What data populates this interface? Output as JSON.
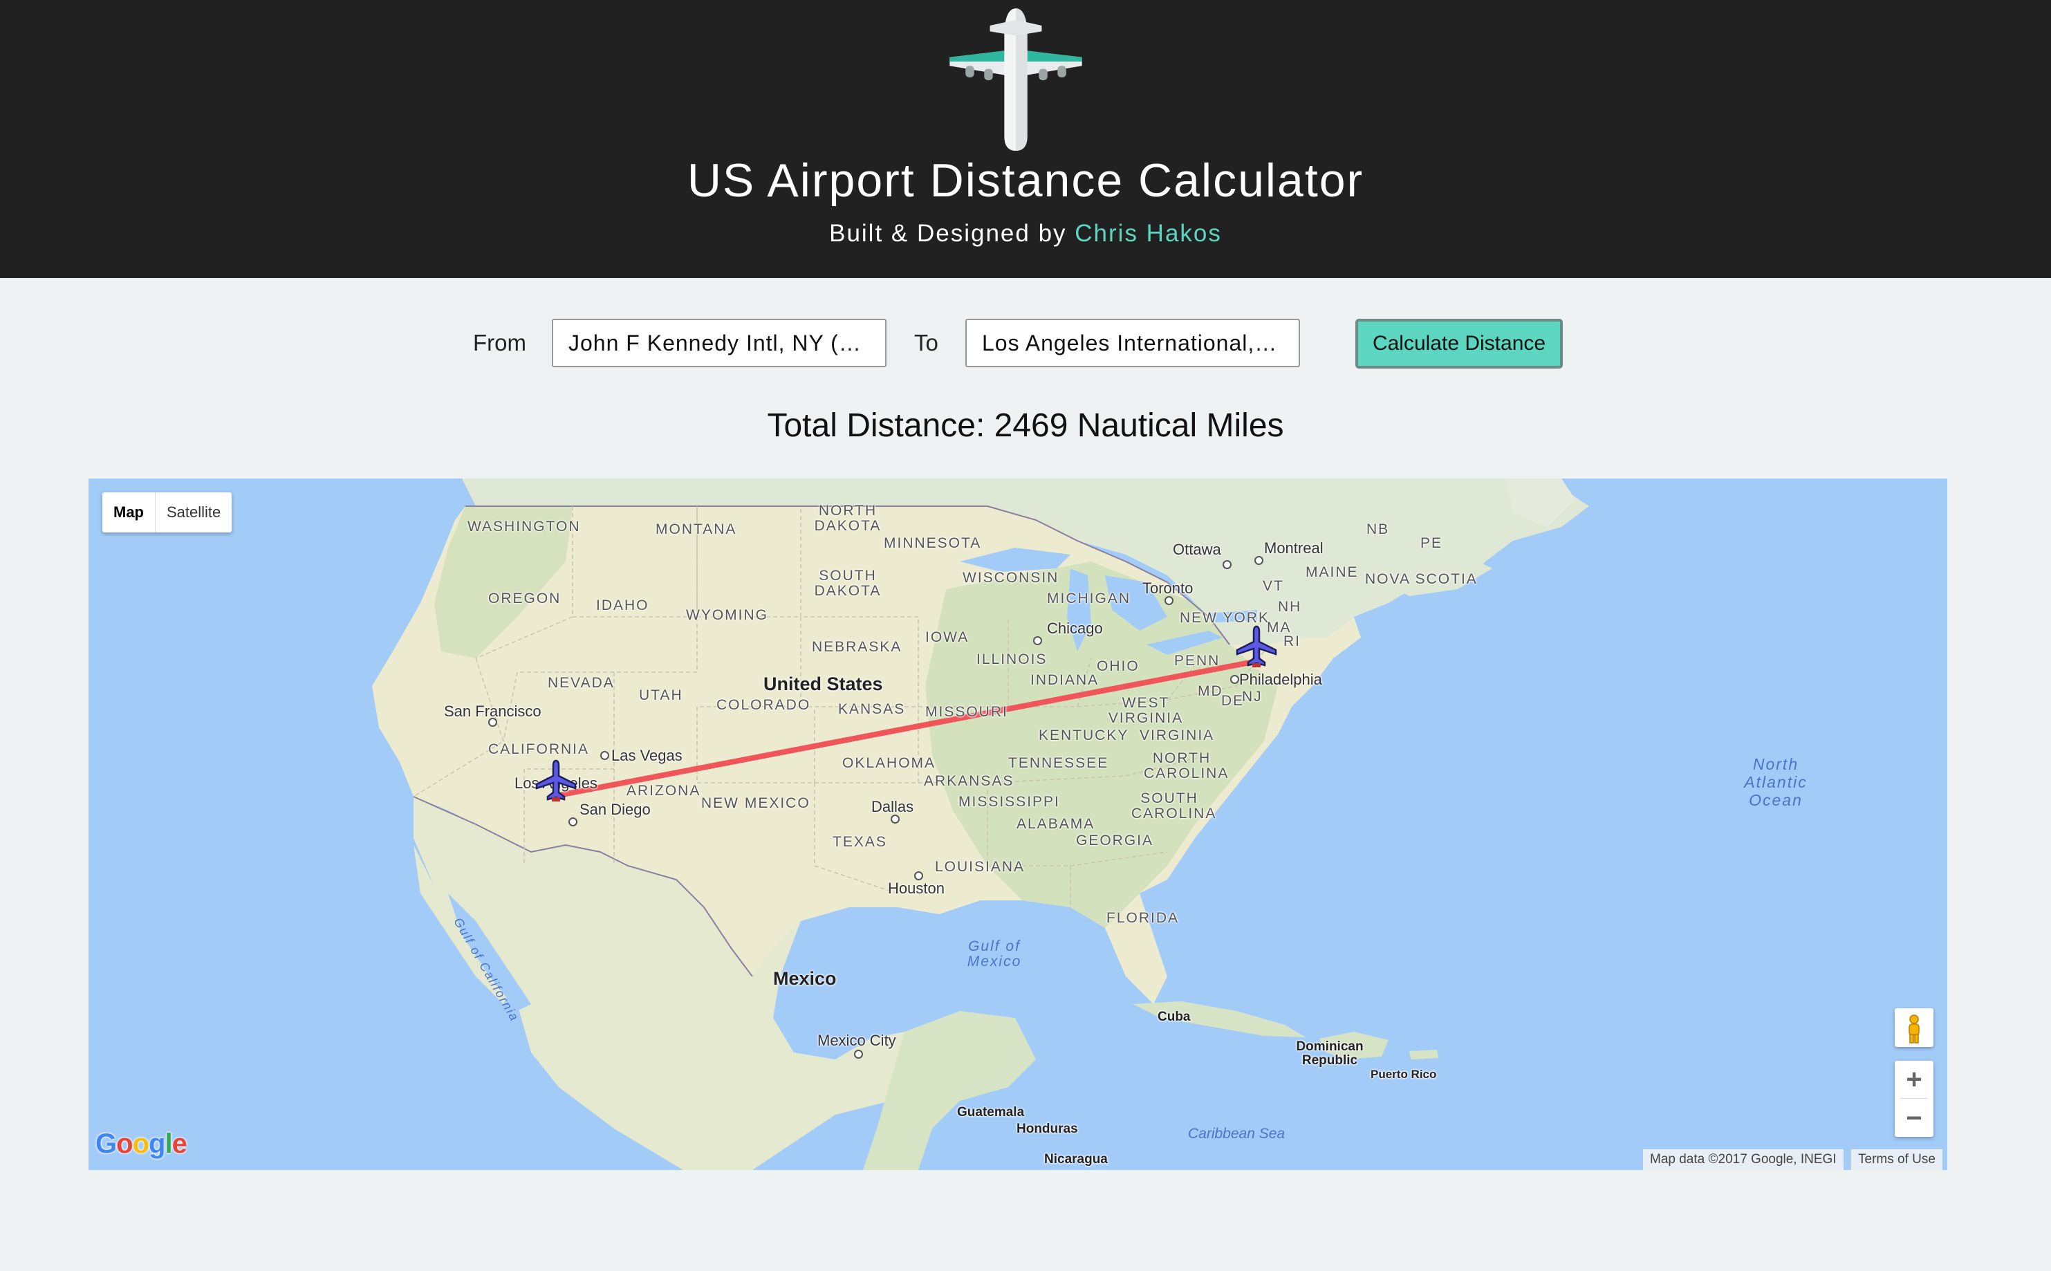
{
  "header": {
    "title": "US Airport Distance Calculator",
    "byline_prefix": "Built & Designed by",
    "author": "Chris Hakos",
    "logo_icon": "airplane-icon",
    "background": "#212121",
    "accent": "#5cd6c0"
  },
  "form": {
    "from_label": "From",
    "from_value": "John F Kennedy Intl, NY (JFK)",
    "to_label": "To",
    "to_value": "Los Angeles International, CA (LAX)",
    "calculate_label": "Calculate Distance"
  },
  "result": {
    "total_text": "Total Distance: 2469 Nautical Miles"
  },
  "map": {
    "type_buttons": [
      "Map",
      "Satellite"
    ],
    "active_type": "Map",
    "route_color": "#f0555a",
    "labels": {
      "states": [
        "WASHINGTON",
        "MONTANA",
        "NORTH DAKOTA",
        "MINNESOTA",
        "OREGON",
        "IDAHO",
        "SOUTH DAKOTA",
        "WISCONSIN",
        "WYOMING",
        "MICHIGAN",
        "NEBRASKA",
        "IOWA",
        "NEVADA",
        "UTAH",
        "COLORADO",
        "KANSAS",
        "MISSOURI",
        "ILLINOIS",
        "INDIANA",
        "OHIO",
        "PENN",
        "NEW YORK",
        "CALIFORNIA",
        "ARIZONA",
        "NEW MEXICO",
        "OKLAHOMA",
        "ARKANSAS",
        "TENNESSEE",
        "KENTUCKY",
        "WEST VIRGINIA",
        "VIRGINIA",
        "NORTH CAROLINA",
        "SOUTH CAROLINA",
        "MISSISSIPPI",
        "ALABAMA",
        "GEORGIA",
        "TEXAS",
        "LOUISIANA",
        "FLORIDA",
        "MAINE",
        "NOVA SCOTIA",
        "NB",
        "PE",
        "VT",
        "NH",
        "MA",
        "RI",
        "MD",
        "DE",
        "NJ"
      ],
      "cities": [
        "Ottawa",
        "Montreal",
        "Toronto",
        "Chicago",
        "Philadelphia",
        "San Francisco",
        "Las Vegas",
        "Los Angeles",
        "San Diego",
        "Dallas",
        "Houston",
        "Mexico City",
        "Cuba",
        "Dominican Republic",
        "Puerto Rico",
        "Guatemala",
        "Honduras",
        "Nicaragua"
      ],
      "countries": [
        "United States",
        "Mexico"
      ],
      "water": [
        "North Atlantic Ocean",
        "Gulf of Mexico",
        "Gulf of California",
        "Caribbean Sea"
      ]
    },
    "attribution": "Map data ©2017 Google, INEGI",
    "terms": "Terms of Use",
    "logo_text": "Google",
    "zoom_in": "+",
    "zoom_out": "−",
    "origin_marker": "airplane-marker-jfk",
    "destination_marker": "airplane-marker-lax"
  }
}
